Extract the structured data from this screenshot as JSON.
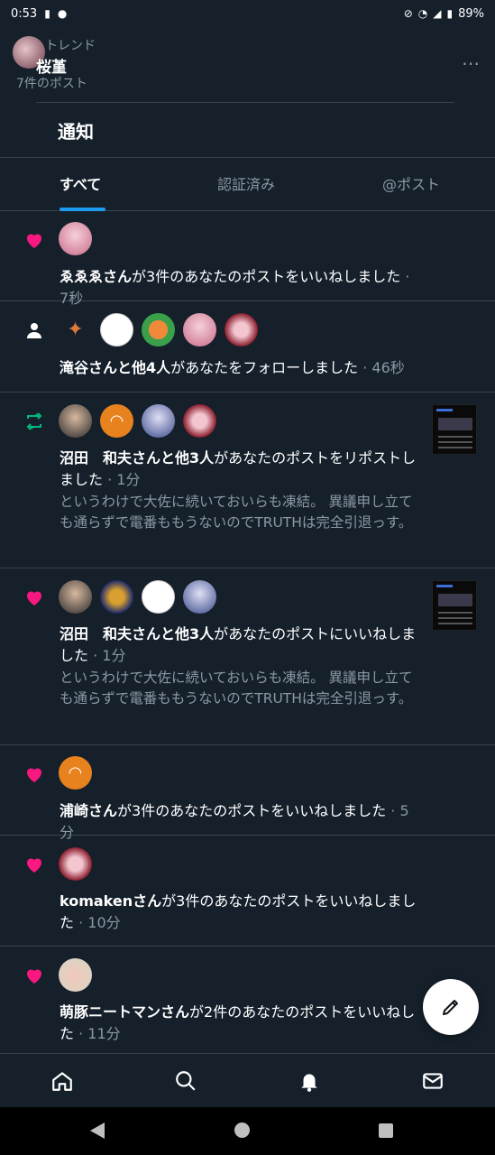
{
  "status_bar": {
    "time": "0:53",
    "battery": "89%"
  },
  "header": {
    "trend_label": "トレンド",
    "name": "桜堇",
    "post_count": "7件のポスト",
    "more": "⋯"
  },
  "page_title": "通知",
  "tabs": [
    {
      "label": "すべて",
      "active": true
    },
    {
      "label": "認証済み",
      "active": false
    },
    {
      "label": "@ポスト",
      "active": false
    }
  ],
  "notifications": [
    {
      "type": "like",
      "bold": "ゑゑゑさん",
      "rest": "が3件のあなたのポストをいいねしました",
      "time": " · 7秒"
    },
    {
      "type": "follow",
      "bold": "滝谷さんと他4人",
      "rest": "があなたをフォローしました",
      "time": " · 46秒"
    },
    {
      "type": "repost",
      "bold": "沼田　和夫さんと他3人",
      "rest": "があなたのポストをリポストしました",
      "time": " · 1分",
      "quote": "というわけで大佐に続いておいらも凍結。 異議申し立ても通らずで電番ももうないのでTRUTHは完全引退っす。"
    },
    {
      "type": "like",
      "bold": "沼田　和夫さんと他3人",
      "rest": "があなたのポストにいいねしました",
      "time": " · 1分",
      "quote": "というわけで大佐に続いておいらも凍結。 異議申し立ても通らずで電番ももうないのでTRUTHは完全引退っす。"
    },
    {
      "type": "like",
      "bold": "浦崎さん",
      "rest": "が3件のあなたのポストをいいねしました",
      "time": " · 5分"
    },
    {
      "type": "like",
      "bold": "komakenさん",
      "rest": "が3件のあなたのポストをいいねしました",
      "time": " · 10分"
    },
    {
      "type": "like",
      "bold": "萌豚ニートマンさん",
      "rest": "が2件のあなたのポストをいいねした",
      "time": " · 11分"
    }
  ],
  "colors": {
    "background": "#15202b",
    "like": "#f91880",
    "repost": "#00ba7c",
    "accent": "#1d9bf0",
    "muted": "#8b98a5"
  },
  "icons": {
    "home": "home-icon",
    "search": "search-icon",
    "notifications": "bell-icon",
    "messages": "mail-icon",
    "compose": "pencil-icon"
  }
}
